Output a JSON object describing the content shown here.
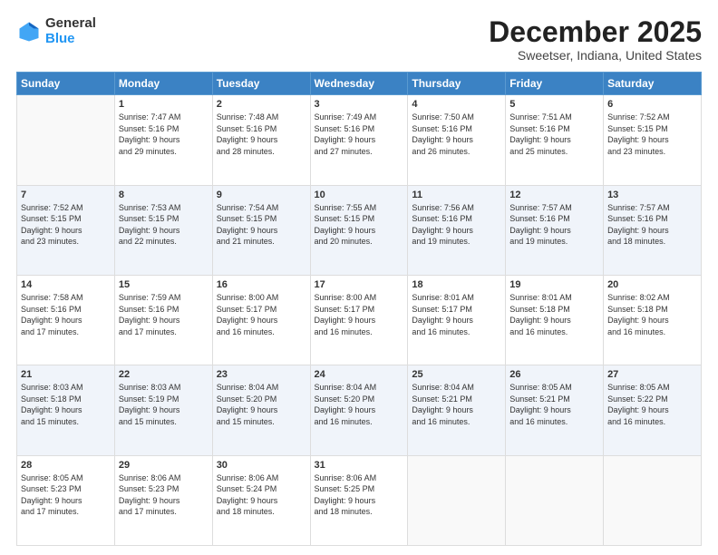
{
  "header": {
    "logo_line1": "General",
    "logo_line2": "Blue",
    "month": "December 2025",
    "location": "Sweetser, Indiana, United States"
  },
  "weekdays": [
    "Sunday",
    "Monday",
    "Tuesday",
    "Wednesday",
    "Thursday",
    "Friday",
    "Saturday"
  ],
  "weeks": [
    [
      {
        "day": "",
        "info": ""
      },
      {
        "day": "1",
        "info": "Sunrise: 7:47 AM\nSunset: 5:16 PM\nDaylight: 9 hours\nand 29 minutes."
      },
      {
        "day": "2",
        "info": "Sunrise: 7:48 AM\nSunset: 5:16 PM\nDaylight: 9 hours\nand 28 minutes."
      },
      {
        "day": "3",
        "info": "Sunrise: 7:49 AM\nSunset: 5:16 PM\nDaylight: 9 hours\nand 27 minutes."
      },
      {
        "day": "4",
        "info": "Sunrise: 7:50 AM\nSunset: 5:16 PM\nDaylight: 9 hours\nand 26 minutes."
      },
      {
        "day": "5",
        "info": "Sunrise: 7:51 AM\nSunset: 5:16 PM\nDaylight: 9 hours\nand 25 minutes."
      },
      {
        "day": "6",
        "info": "Sunrise: 7:52 AM\nSunset: 5:15 PM\nDaylight: 9 hours\nand 23 minutes."
      }
    ],
    [
      {
        "day": "7",
        "info": "Sunrise: 7:52 AM\nSunset: 5:15 PM\nDaylight: 9 hours\nand 23 minutes."
      },
      {
        "day": "8",
        "info": "Sunrise: 7:53 AM\nSunset: 5:15 PM\nDaylight: 9 hours\nand 22 minutes."
      },
      {
        "day": "9",
        "info": "Sunrise: 7:54 AM\nSunset: 5:15 PM\nDaylight: 9 hours\nand 21 minutes."
      },
      {
        "day": "10",
        "info": "Sunrise: 7:55 AM\nSunset: 5:15 PM\nDaylight: 9 hours\nand 20 minutes."
      },
      {
        "day": "11",
        "info": "Sunrise: 7:56 AM\nSunset: 5:16 PM\nDaylight: 9 hours\nand 19 minutes."
      },
      {
        "day": "12",
        "info": "Sunrise: 7:57 AM\nSunset: 5:16 PM\nDaylight: 9 hours\nand 19 minutes."
      },
      {
        "day": "13",
        "info": "Sunrise: 7:57 AM\nSunset: 5:16 PM\nDaylight: 9 hours\nand 18 minutes."
      }
    ],
    [
      {
        "day": "14",
        "info": "Sunrise: 7:58 AM\nSunset: 5:16 PM\nDaylight: 9 hours\nand 17 minutes."
      },
      {
        "day": "15",
        "info": "Sunrise: 7:59 AM\nSunset: 5:16 PM\nDaylight: 9 hours\nand 17 minutes."
      },
      {
        "day": "16",
        "info": "Sunrise: 8:00 AM\nSunset: 5:17 PM\nDaylight: 9 hours\nand 16 minutes."
      },
      {
        "day": "17",
        "info": "Sunrise: 8:00 AM\nSunset: 5:17 PM\nDaylight: 9 hours\nand 16 minutes."
      },
      {
        "day": "18",
        "info": "Sunrise: 8:01 AM\nSunset: 5:17 PM\nDaylight: 9 hours\nand 16 minutes."
      },
      {
        "day": "19",
        "info": "Sunrise: 8:01 AM\nSunset: 5:18 PM\nDaylight: 9 hours\nand 16 minutes."
      },
      {
        "day": "20",
        "info": "Sunrise: 8:02 AM\nSunset: 5:18 PM\nDaylight: 9 hours\nand 16 minutes."
      }
    ],
    [
      {
        "day": "21",
        "info": "Sunrise: 8:03 AM\nSunset: 5:18 PM\nDaylight: 9 hours\nand 15 minutes."
      },
      {
        "day": "22",
        "info": "Sunrise: 8:03 AM\nSunset: 5:19 PM\nDaylight: 9 hours\nand 15 minutes."
      },
      {
        "day": "23",
        "info": "Sunrise: 8:04 AM\nSunset: 5:20 PM\nDaylight: 9 hours\nand 15 minutes."
      },
      {
        "day": "24",
        "info": "Sunrise: 8:04 AM\nSunset: 5:20 PM\nDaylight: 9 hours\nand 16 minutes."
      },
      {
        "day": "25",
        "info": "Sunrise: 8:04 AM\nSunset: 5:21 PM\nDaylight: 9 hours\nand 16 minutes."
      },
      {
        "day": "26",
        "info": "Sunrise: 8:05 AM\nSunset: 5:21 PM\nDaylight: 9 hours\nand 16 minutes."
      },
      {
        "day": "27",
        "info": "Sunrise: 8:05 AM\nSunset: 5:22 PM\nDaylight: 9 hours\nand 16 minutes."
      }
    ],
    [
      {
        "day": "28",
        "info": "Sunrise: 8:05 AM\nSunset: 5:23 PM\nDaylight: 9 hours\nand 17 minutes."
      },
      {
        "day": "29",
        "info": "Sunrise: 8:06 AM\nSunset: 5:23 PM\nDaylight: 9 hours\nand 17 minutes."
      },
      {
        "day": "30",
        "info": "Sunrise: 8:06 AM\nSunset: 5:24 PM\nDaylight: 9 hours\nand 18 minutes."
      },
      {
        "day": "31",
        "info": "Sunrise: 8:06 AM\nSunset: 5:25 PM\nDaylight: 9 hours\nand 18 minutes."
      },
      {
        "day": "",
        "info": ""
      },
      {
        "day": "",
        "info": ""
      },
      {
        "day": "",
        "info": ""
      }
    ]
  ]
}
